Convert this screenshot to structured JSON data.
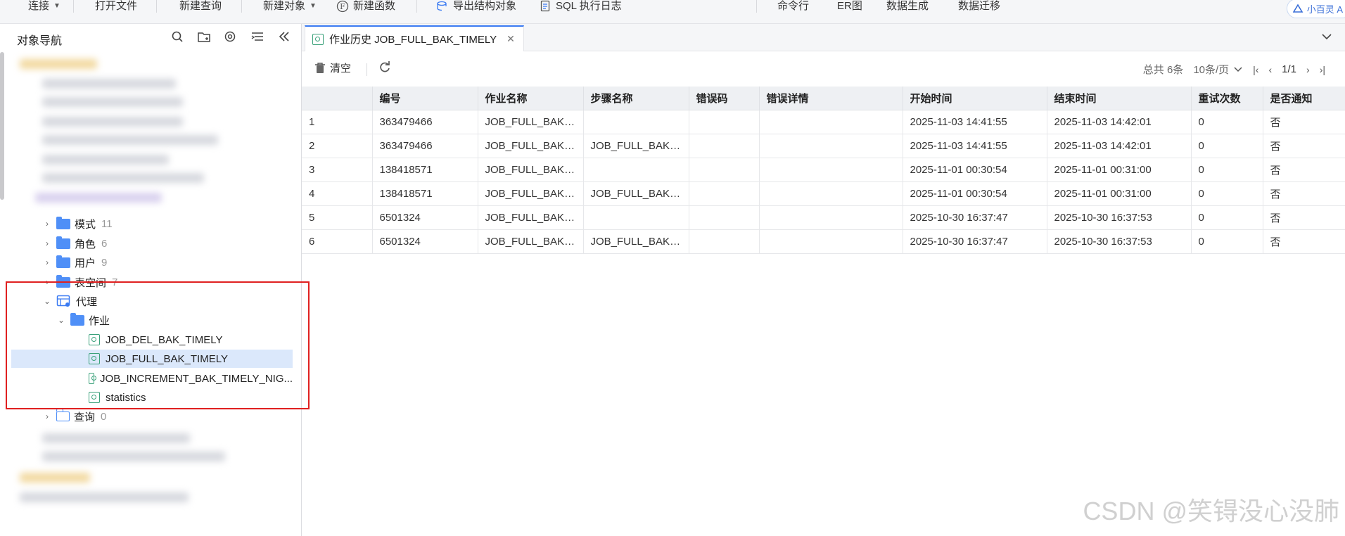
{
  "toolbar": {
    "items": [
      "连接",
      "打开文件",
      "新建查询",
      "新建对象",
      "新建函数",
      "导出结构对象",
      "SQL 执行日志",
      "命令行",
      "ER图",
      "数据生成",
      "数据迁移"
    ],
    "ai_label": "小百灵 A"
  },
  "nav": {
    "title": "对象导航",
    "tree": [
      {
        "label": "模式",
        "count": "11"
      },
      {
        "label": "角色",
        "count": "6"
      },
      {
        "label": "用户",
        "count": "9"
      },
      {
        "label": "表空间",
        "count": "7"
      },
      {
        "label": "代理",
        "count": ""
      },
      {
        "label": "作业",
        "count": ""
      },
      {
        "label": "JOB_DEL_BAK_TIMELY",
        "count": ""
      },
      {
        "label": "JOB_FULL_BAK_TIMELY",
        "count": ""
      },
      {
        "label": "JOB_INCREMENT_BAK_TIMELY_NIG...",
        "count": ""
      },
      {
        "label": "statistics",
        "count": ""
      },
      {
        "label": "查询",
        "count": "0"
      }
    ]
  },
  "tab": {
    "label": "作业历史 JOB_FULL_BAK_TIMELY"
  },
  "content": {
    "clear_label": "清空",
    "total_label": "总共 6条",
    "page_size_label": "10条/页",
    "page_label": "1/1"
  },
  "table": {
    "columns": [
      "",
      "编号",
      "作业名称",
      "步骤名称",
      "错误码",
      "错误详情",
      "开始时间",
      "结束时间",
      "重试次数",
      "是否通知"
    ],
    "rows": [
      [
        "1",
        "363479466",
        "JOB_FULL_BAK_TI...",
        "",
        "",
        "",
        "2025-11-03 14:41:55",
        "2025-11-03 14:42:01",
        "0",
        "否"
      ],
      [
        "2",
        "363479466",
        "JOB_FULL_BAK_TI...",
        "JOB_FULL_BAK_TI...",
        "",
        "",
        "2025-11-03 14:41:55",
        "2025-11-03 14:42:01",
        "0",
        "否"
      ],
      [
        "3",
        "138418571",
        "JOB_FULL_BAK_TI...",
        "",
        "",
        "",
        "2025-11-01 00:30:54",
        "2025-11-01 00:31:00",
        "0",
        "否"
      ],
      [
        "4",
        "138418571",
        "JOB_FULL_BAK_TI...",
        "JOB_FULL_BAK_TI...",
        "",
        "",
        "2025-11-01 00:30:54",
        "2025-11-01 00:31:00",
        "0",
        "否"
      ],
      [
        "5",
        "6501324",
        "JOB_FULL_BAK_TI...",
        "",
        "",
        "",
        "2025-10-30 16:37:47",
        "2025-10-30 16:37:53",
        "0",
        "否"
      ],
      [
        "6",
        "6501324",
        "JOB_FULL_BAK_TI...",
        "JOB_FULL_BAK_TI...",
        "",
        "",
        "2025-10-30 16:37:47",
        "2025-10-30 16:37:53",
        "0",
        "否"
      ]
    ]
  },
  "watermark": "CSDN @笑锝没心没肺",
  "colors": {
    "accent": "#3a7af2",
    "folder": "#4f8ff7",
    "highlight": "#e02020",
    "selected": "#dbe8fb"
  }
}
